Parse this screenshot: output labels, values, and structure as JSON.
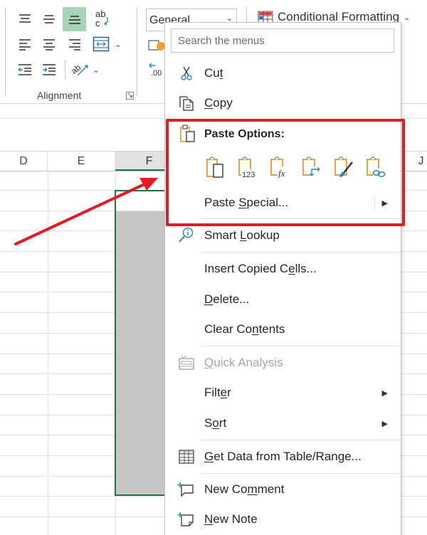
{
  "ribbon": {
    "alignment_group_label": "Alignment",
    "number_format_value": "General",
    "conditional_formatting_label": "Conditional Formatting",
    "alignment_buttons": [
      {
        "icon": "align-top-icon",
        "active": false
      },
      {
        "icon": "align-middle-icon",
        "active": false
      },
      {
        "icon": "align-bottom-icon",
        "active": true
      },
      {
        "icon": "wrap-text-icon",
        "active": false
      },
      {
        "icon": "align-left-icon",
        "active": false
      },
      {
        "icon": "align-center-icon",
        "active": false
      },
      {
        "icon": "align-right-icon",
        "active": false
      },
      {
        "icon": "merge-center-icon",
        "active": false
      },
      {
        "icon": "decrease-indent-icon",
        "active": false
      },
      {
        "icon": "increase-indent-icon",
        "active": false
      },
      {
        "icon": "orientation-icon",
        "active": false
      }
    ]
  },
  "grid": {
    "columns": [
      {
        "label": "D",
        "selected": false
      },
      {
        "label": "E",
        "selected": false
      },
      {
        "label": "F",
        "selected": true
      },
      {
        "label": "J",
        "selected": false
      }
    ],
    "selection_fill_color": "#c6c6c6",
    "selection_border_color": "#217346"
  },
  "context_menu": {
    "search_placeholder": "Search the menus",
    "cut": {
      "pre": "Cu",
      "key": "t",
      "post": ""
    },
    "copy": {
      "pre": "",
      "key": "C",
      "post": "opy"
    },
    "paste_options_label": "Paste Options:",
    "paste_icons": [
      "paste-icon",
      "paste-values-icon",
      "paste-formulas-icon",
      "paste-transpose-icon",
      "paste-formatting-icon",
      "paste-link-icon"
    ],
    "paste_values_text": "123",
    "paste_formulas_text": "fx",
    "paste_special": {
      "pre": "Paste ",
      "key": "S",
      "post": "pecial..."
    },
    "smart_lookup": {
      "pre": "Smart ",
      "key": "L",
      "post": "ookup"
    },
    "insert_copied_cells": {
      "pre": "Insert Copied C",
      "key": "e",
      "post": "lls..."
    },
    "delete": {
      "pre": "",
      "key": "D",
      "post": "elete..."
    },
    "clear_contents": {
      "pre": "Clear Co",
      "key": "n",
      "post": "tents"
    },
    "quick_analysis": {
      "pre": "",
      "key": "Q",
      "post": "uick Analysis",
      "disabled": true
    },
    "filter": {
      "pre": "Filt",
      "key": "e",
      "post": "r"
    },
    "sort": {
      "pre": "S",
      "key": "o",
      "post": "rt"
    },
    "get_data": {
      "pre": "",
      "key": "G",
      "post": "et Data from Table/Range..."
    },
    "new_comment": {
      "pre": "New Co",
      "key": "m",
      "post": "ment"
    },
    "new_note": {
      "pre": "",
      "key": "N",
      "post": "ew Note"
    }
  },
  "annotation": {
    "highlight_color": "#e31b23",
    "arrow_color": "#e31b23"
  }
}
